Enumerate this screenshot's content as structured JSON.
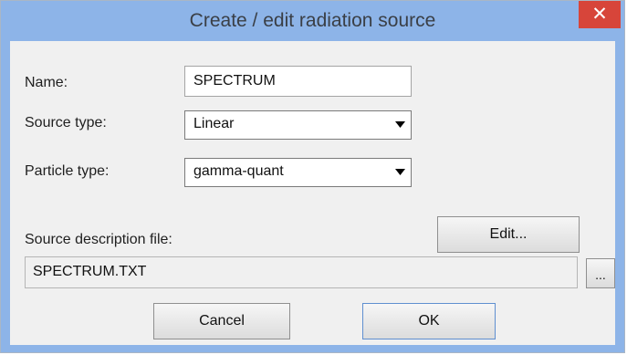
{
  "window": {
    "title": "Create / edit radiation source",
    "close_glyph": "✕"
  },
  "form": {
    "name_label": "Name:",
    "name_value": "SPECTRUM",
    "source_type_label": "Source type:",
    "source_type_value": "Linear",
    "particle_type_label": "Particle type:",
    "particle_type_value": "gamma-quant",
    "source_file_label": "Source description file:",
    "source_file_value": "SPECTRUM.TXT"
  },
  "buttons": {
    "edit_label": "Edit...",
    "browse_label": "...",
    "cancel_label": "Cancel",
    "ok_label": "OK"
  },
  "colors": {
    "title_bar": "#8db4e8",
    "close_button": "#d7453a",
    "dialog_background": "#f0f0f0"
  }
}
